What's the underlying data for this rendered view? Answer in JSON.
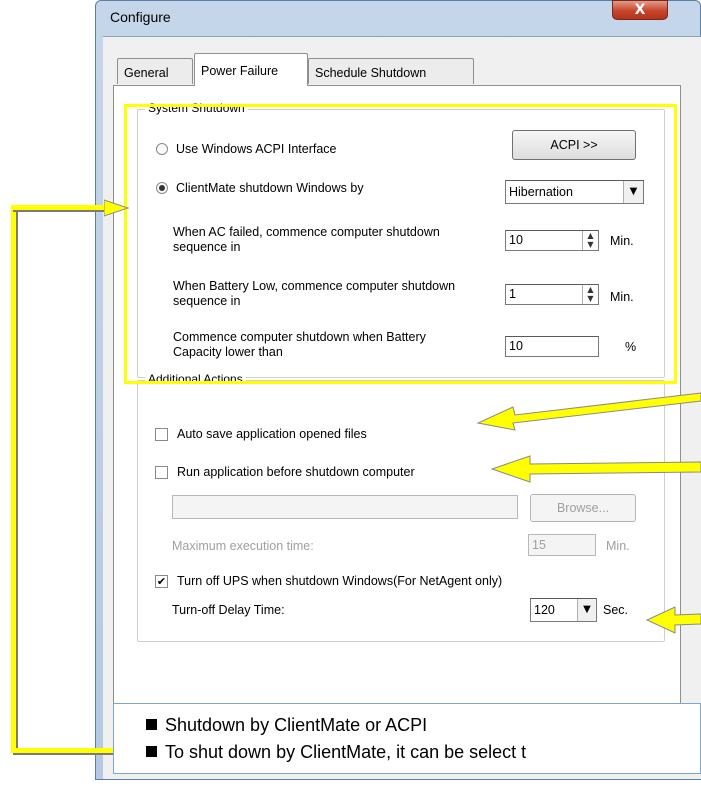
{
  "window": {
    "title": "Configure",
    "close_glyph": "X"
  },
  "tabs": [
    {
      "label": "General"
    },
    {
      "label": "Power Failure",
      "active": true
    },
    {
      "label": "Schedule Shutdown"
    }
  ],
  "system_shutdown": {
    "group_label": "System Shutdown",
    "acpi_radio_label": "Use Windows ACPI Interface",
    "acpi_button_label": "ACPI >>",
    "clientmate_radio_label": "ClientMate shutdown Windows by",
    "shutdown_method": "Hibernation",
    "ac_failed_label": "When AC failed, commence computer shutdown sequence in",
    "ac_failed_value": "10",
    "ac_failed_unit": "Min.",
    "battery_low_label": "When Battery Low, commence computer shutdown sequence in",
    "battery_low_value": "1",
    "battery_low_unit": "Min.",
    "capacity_label": "Commence computer shutdown when Battery Capacity lower than",
    "capacity_value": "10",
    "capacity_unit": "%"
  },
  "additional_actions": {
    "group_label": "Additional Actions",
    "auto_save_label": "Auto save application opened files",
    "auto_save_checked": false,
    "run_app_label": "Run application before shutdown computer",
    "run_app_checked": false,
    "app_path_value": "",
    "browse_label": "Browse...",
    "max_exec_label": "Maximum execution time:",
    "max_exec_value": "15",
    "max_exec_unit": "Min.",
    "turn_off_ups_label": "Turn off UPS when shutdown Windows(For NetAgent only)",
    "turn_off_ups_checked": true,
    "check_glyph": "✔",
    "delay_label": "Turn-off Delay Time:",
    "delay_value": "120",
    "delay_unit": "Sec."
  },
  "icons": {
    "spin_up": "▲",
    "spin_down": "▼",
    "dropdown": "▼"
  },
  "annotation": {
    "color": "#ffff00",
    "lines": [
      "Shutdown by ClientMate or ACPI",
      "To shut down by ClientMate, it can be select t"
    ]
  }
}
